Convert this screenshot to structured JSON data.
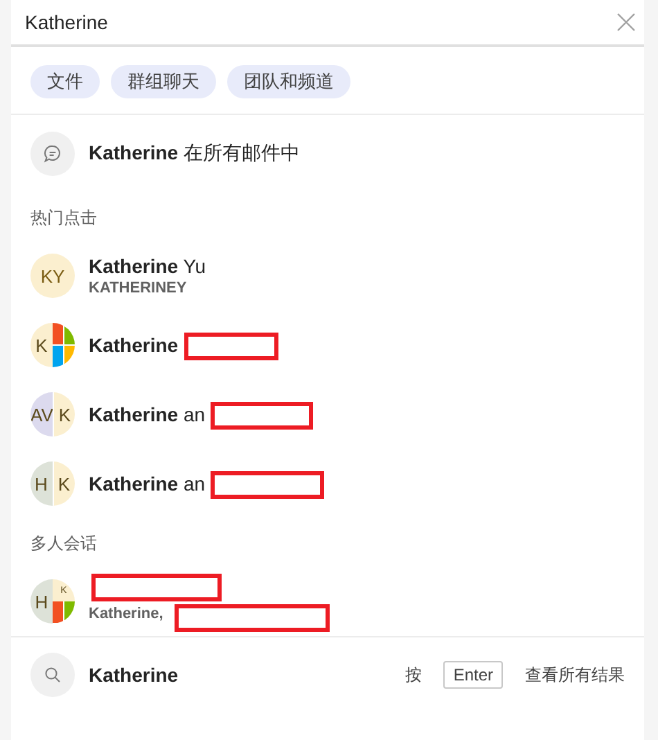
{
  "search": {
    "value": "Katherine"
  },
  "filters": [
    "文件",
    "群组聊天",
    "团队和频道"
  ],
  "mail_search": {
    "name": "Katherine",
    "rest": "在所有邮件中"
  },
  "sections": [
    {
      "title": "热门点击",
      "items": [
        {
          "name": "Katherine",
          "rest": "Yu",
          "subtitle": "KATHERINEY",
          "redacted": false,
          "avatar": {
            "kind": "initials",
            "parts": [
              {
                "text": "KY",
                "color": "#fbefcf"
              }
            ]
          }
        },
        {
          "name": "Katherine",
          "redacted": true,
          "avatar": {
            "kind": "tiles",
            "parts": [
              {
                "text": "K",
                "color": "#fbefcf"
              }
            ]
          }
        },
        {
          "name": "Katherine",
          "rest": "an",
          "redacted": true,
          "avatar": {
            "kind": "split",
            "parts": [
              {
                "text": "AV",
                "color": "#dcdaee"
              },
              {
                "text": "K",
                "color": "#fbefcf"
              }
            ]
          }
        },
        {
          "name": "Katherine",
          "rest": "an",
          "redacted": true,
          "avatar": {
            "kind": "split",
            "parts": [
              {
                "text": "H",
                "color": "#dde2d8"
              },
              {
                "text": "K",
                "color": "#fbefcf"
              }
            ]
          }
        }
      ]
    },
    {
      "title": "多人会话",
      "items": [
        {
          "subtitle": "Katherine,",
          "redacted": true,
          "avatar": {
            "kind": "group",
            "parts": [
              {
                "text": "H",
                "color": "#dde2d8"
              },
              {
                "text": "K",
                "color": "#fbefcf"
              }
            ]
          }
        }
      ]
    }
  ],
  "footer": {
    "query": "Katherine",
    "hint_before": "按",
    "key": "Enter",
    "hint_after": "查看所有结果"
  }
}
